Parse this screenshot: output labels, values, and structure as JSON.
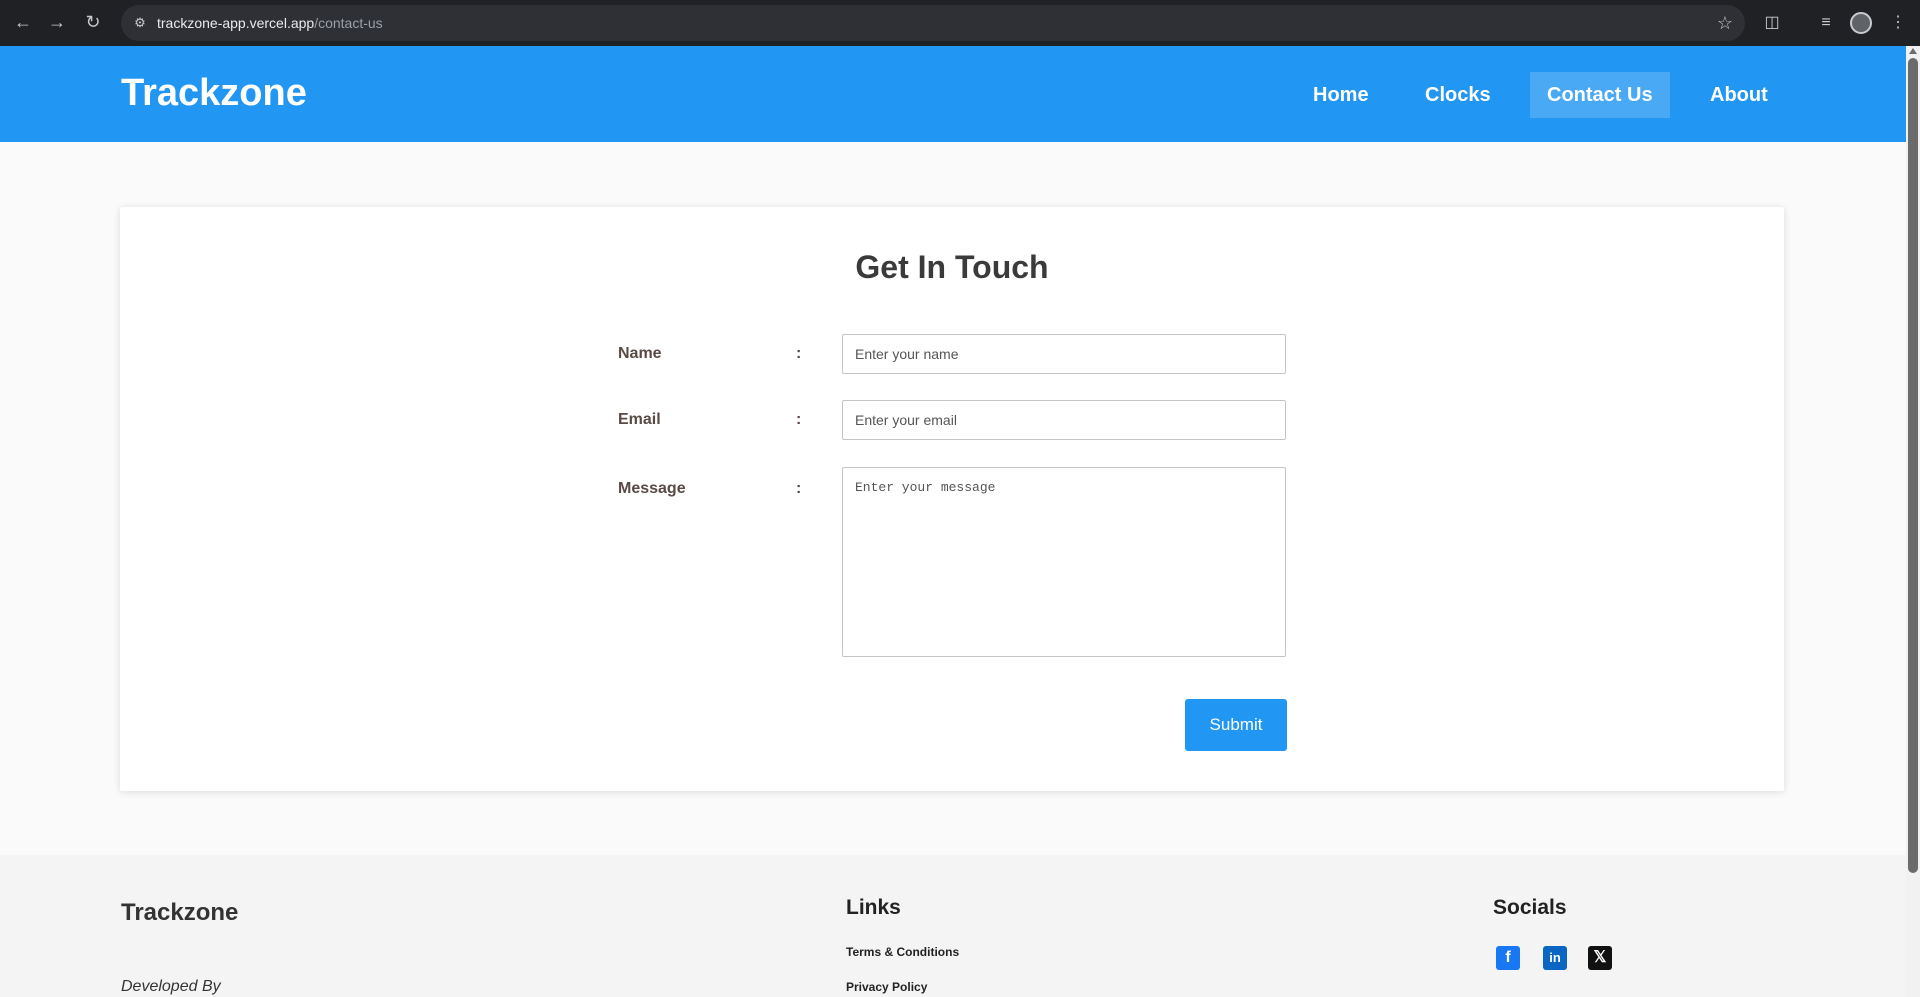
{
  "browser": {
    "url_host": "trackzone-app.vercel.app",
    "url_path": "/contact-us",
    "icons": [
      "back-arrow-icon",
      "forward-arrow-icon",
      "reload-icon",
      "site-info-icon",
      "star-icon",
      "extensions-icon",
      "media-controls-icon",
      "profile-avatar",
      "more-menu-icon"
    ]
  },
  "header": {
    "brand": "Trackzone",
    "nav": [
      "Home",
      "Clocks",
      "Contact Us",
      "About"
    ],
    "active_nav": "Contact Us",
    "color": "#2196f3"
  },
  "form": {
    "title": "Get In Touch",
    "name_label": "Name",
    "email_label": "Email",
    "message_label": "Message",
    "colon": ":",
    "name_placeholder": "Enter your name",
    "email_placeholder": "Enter your email",
    "message_placeholder": "Enter your message",
    "submit_label": "Submit"
  },
  "footer": {
    "brand": "Trackzone",
    "developed_by": "Developed By",
    "links_heading": "Links",
    "links": [
      "Terms & Conditions",
      "Privacy Policy"
    ],
    "socials_heading": "Socials",
    "socials": [
      "facebook-icon",
      "linkedin-icon",
      "x-twitter-icon"
    ]
  }
}
